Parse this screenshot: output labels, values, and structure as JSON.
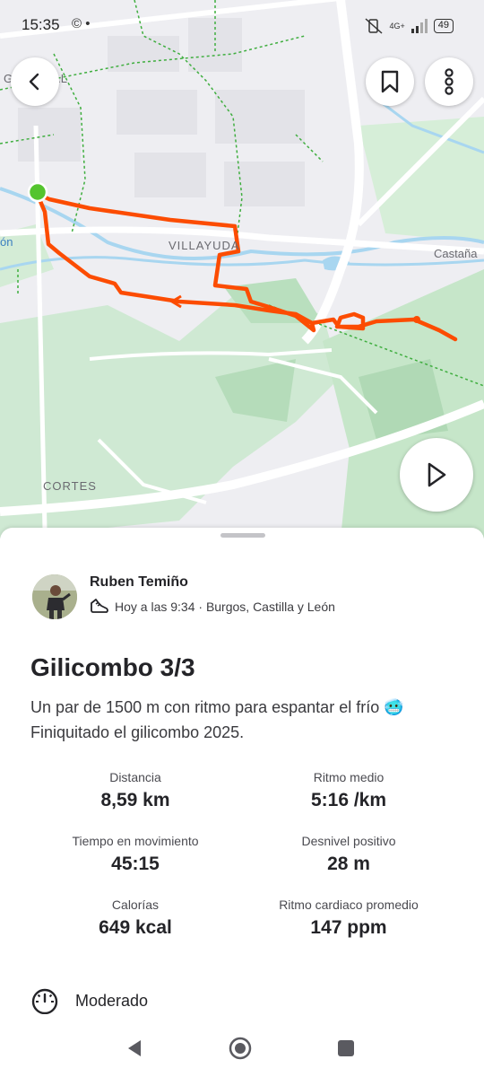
{
  "status_bar": {
    "time": "15:35",
    "left_icons": "© •",
    "network": "4G+",
    "battery": "49"
  },
  "map": {
    "labels": {
      "top_left": "GAMONAL",
      "villayuda": "VILLAYUDA",
      "castanares": "Castaña",
      "leon": "ón",
      "cortes": "CORTES"
    },
    "route_color": "#fc4c02",
    "start_color": "#54c42e"
  },
  "sheet": {
    "athlete": "Ruben Temiño",
    "meta": "Hoy a las 9:34 · Burgos, Castilla y León",
    "title": "Gilicombo 3/3",
    "description": "Un par de 1500 m con ritmo para espantar el frío 🥶 Finiquitado el gilicombo 2025.",
    "stats": [
      {
        "label": "Distancia",
        "value": "8,59 km"
      },
      {
        "label": "Ritmo medio",
        "value": "5:16 /km"
      },
      {
        "label": "Tiempo en movimiento",
        "value": "45:15"
      },
      {
        "label": "Desnivel positivo",
        "value": "28 m"
      },
      {
        "label": "Calorías",
        "value": "649 kcal"
      },
      {
        "label": "Ritmo cardiaco promedio",
        "value": "147 ppm"
      }
    ],
    "intensity": "Moderado"
  },
  "icons": {
    "back": "back-arrow-icon",
    "bookmark": "bookmark-icon",
    "more": "more-vertical-icon",
    "play": "play-icon",
    "shoe": "running-shoe-icon",
    "gauge": "gauge-icon"
  }
}
